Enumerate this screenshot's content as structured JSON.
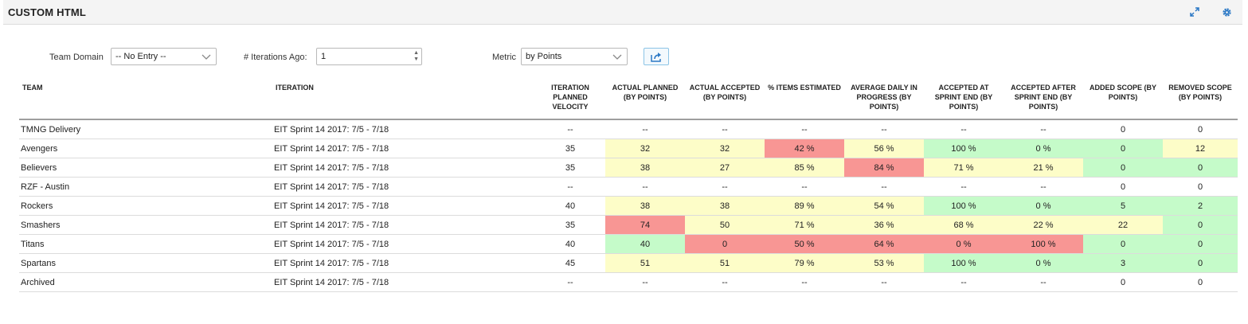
{
  "header": {
    "title": "CUSTOM HTML"
  },
  "filters": {
    "team_domain_label": "Team Domain",
    "team_domain_value": "-- No Entry --",
    "iterations_ago_label": "# Iterations Ago:",
    "iterations_ago_value": "1",
    "metric_label": "Metric",
    "metric_value": "by Points"
  },
  "colors": {
    "red": "#f89694",
    "yellow": "#fdfdc8",
    "green": "#c5fbc9",
    "accent": "#2b78c5"
  },
  "table": {
    "columns": [
      "TEAM",
      "ITERATION",
      "ITERATION PLANNED VELOCITY",
      "ACTUAL PLANNED (BY POINTS)",
      "ACTUAL ACCEPTED (BY POINTS)",
      "% ITEMS ESTIMATED",
      "AVERAGE DAILY IN PROGRESS (BY POINTS)",
      "ACCEPTED AT SPRINT END (BY POINTS)",
      "ACCEPTED AFTER SPRINT END (BY POINTS)",
      "ADDED SCOPE (BY POINTS)",
      "REMOVED SCOPE (BY POINTS)"
    ],
    "rows": [
      {
        "cells": [
          "TMNG Delivery",
          "EIT Sprint 14 2017: 7/5 - 7/18",
          "--",
          "--",
          "--",
          "--",
          "--",
          "--",
          "--",
          "0",
          "0"
        ],
        "status": [
          "",
          "",
          "",
          "",
          "",
          "",
          "",
          "",
          "",
          "",
          ""
        ]
      },
      {
        "cells": [
          "Avengers",
          "EIT Sprint 14 2017: 7/5 - 7/18",
          "35",
          "32",
          "32",
          "42 %",
          "56 %",
          "100 %",
          "0 %",
          "0",
          "12"
        ],
        "status": [
          "",
          "",
          "",
          "yellow",
          "yellow",
          "red",
          "yellow",
          "green",
          "green",
          "green",
          "yellow"
        ]
      },
      {
        "cells": [
          "Believers",
          "EIT Sprint 14 2017: 7/5 - 7/18",
          "35",
          "38",
          "27",
          "85 %",
          "84 %",
          "71 %",
          "21 %",
          "0",
          "0"
        ],
        "status": [
          "",
          "",
          "",
          "yellow",
          "yellow",
          "yellow",
          "red",
          "yellow",
          "yellow",
          "green",
          "green"
        ]
      },
      {
        "cells": [
          "RZF - Austin",
          "EIT Sprint 14 2017: 7/5 - 7/18",
          "--",
          "--",
          "--",
          "--",
          "--",
          "--",
          "--",
          "0",
          "0"
        ],
        "status": [
          "",
          "",
          "",
          "",
          "",
          "",
          "",
          "",
          "",
          "",
          ""
        ]
      },
      {
        "cells": [
          "Rockers",
          "EIT Sprint 14 2017: 7/5 - 7/18",
          "40",
          "38",
          "38",
          "89 %",
          "54 %",
          "100 %",
          "0 %",
          "5",
          "2"
        ],
        "status": [
          "",
          "",
          "",
          "yellow",
          "yellow",
          "yellow",
          "yellow",
          "green",
          "green",
          "green",
          "green"
        ]
      },
      {
        "cells": [
          "Smashers",
          "EIT Sprint 14 2017: 7/5 - 7/18",
          "35",
          "74",
          "50",
          "71 %",
          "36 %",
          "68 %",
          "22 %",
          "22",
          "0"
        ],
        "status": [
          "",
          "",
          "",
          "red",
          "yellow",
          "yellow",
          "yellow",
          "yellow",
          "yellow",
          "yellow",
          "green"
        ]
      },
      {
        "cells": [
          "Titans",
          "EIT Sprint 14 2017: 7/5 - 7/18",
          "40",
          "40",
          "0",
          "50 %",
          "64 %",
          "0 %",
          "100 %",
          "0",
          "0"
        ],
        "status": [
          "",
          "",
          "",
          "green",
          "red",
          "red",
          "red",
          "red",
          "red",
          "green",
          "green"
        ]
      },
      {
        "cells": [
          "Spartans",
          "EIT Sprint 14 2017: 7/5 - 7/18",
          "45",
          "51",
          "51",
          "79 %",
          "53 %",
          "100 %",
          "0 %",
          "3",
          "0"
        ],
        "status": [
          "",
          "",
          "",
          "yellow",
          "yellow",
          "yellow",
          "yellow",
          "green",
          "green",
          "green",
          "green"
        ]
      },
      {
        "cells": [
          "Archived",
          "EIT Sprint 14 2017: 7/5 - 7/18",
          "--",
          "--",
          "--",
          "--",
          "--",
          "--",
          "--",
          "0",
          "0"
        ],
        "status": [
          "",
          "",
          "",
          "",
          "",
          "",
          "",
          "",
          "",
          "",
          ""
        ]
      }
    ]
  }
}
